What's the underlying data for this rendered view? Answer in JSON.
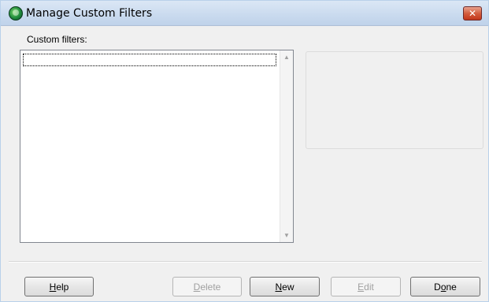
{
  "window": {
    "title": "Manage Custom Filters",
    "close_label": "✕"
  },
  "list": {
    "label": "Custom filters:",
    "items": [
      ""
    ],
    "scroll_up": "▲",
    "scroll_down": "▼"
  },
  "buttons": {
    "help": {
      "prefix": "",
      "accel": "H",
      "rest": "elp",
      "enabled": true
    },
    "delete": {
      "prefix": "",
      "accel": "D",
      "rest": "elete",
      "enabled": false
    },
    "new": {
      "prefix": "",
      "accel": "N",
      "rest": "ew",
      "enabled": true
    },
    "edit": {
      "prefix": "",
      "accel": "E",
      "rest": "dit",
      "enabled": false
    },
    "done": {
      "prefix": "D",
      "accel": "o",
      "rest": "ne",
      "enabled": true
    }
  },
  "colors": {
    "background": "#f0f0f0",
    "titlebar": "#c9daee",
    "close_button": "#d35e3f",
    "disabled_text": "#a0a0a0"
  }
}
